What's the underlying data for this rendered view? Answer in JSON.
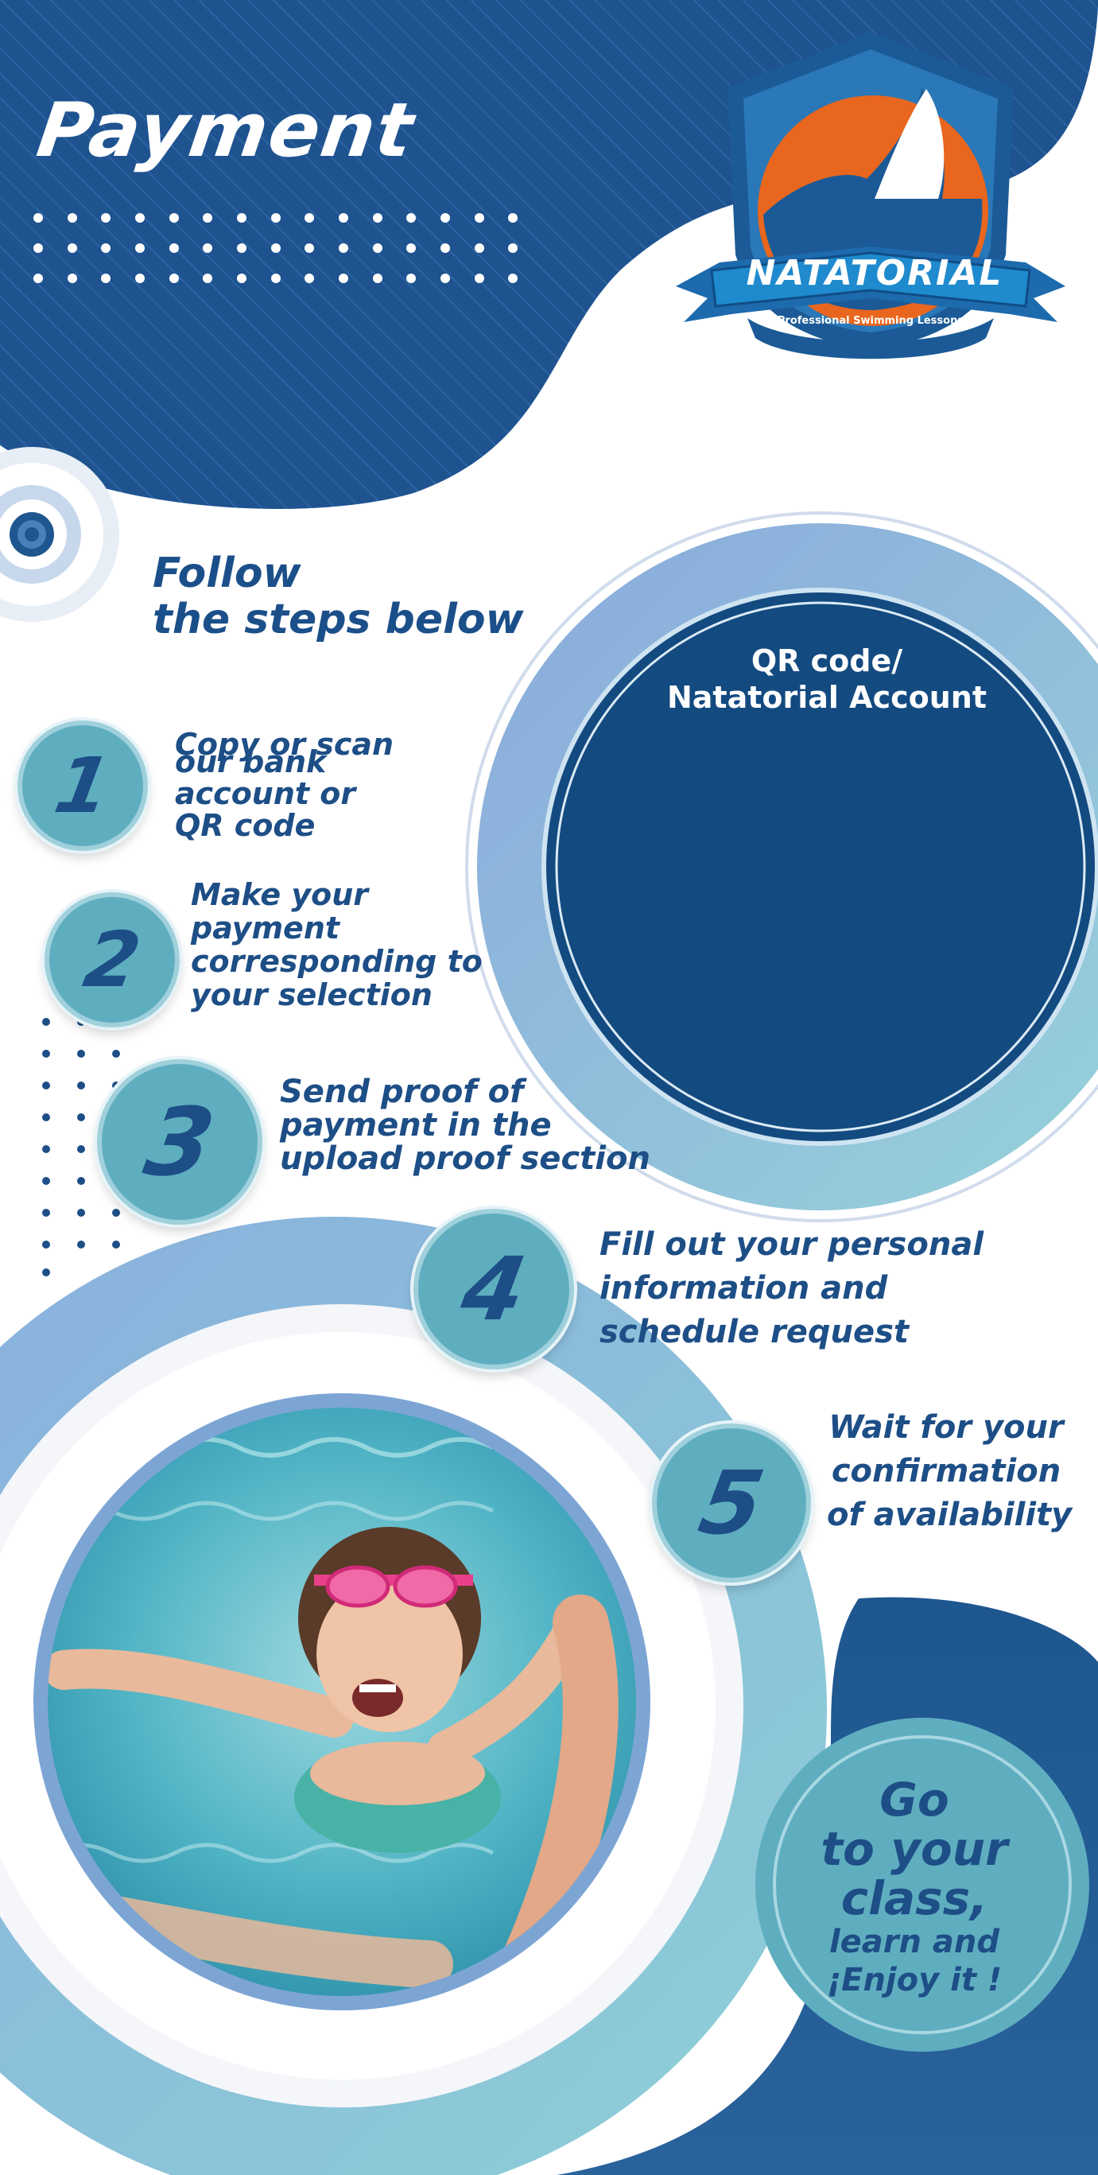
{
  "header": {
    "title": "Payment"
  },
  "logo": {
    "brand": "NATATORIAL",
    "tagline": "Professional Swimming Lessons"
  },
  "intro": {
    "line1": "Follow",
    "line2": "the steps below"
  },
  "qr_panel": {
    "line1": "QR code/",
    "line2": "Natatorial Account"
  },
  "steps": [
    {
      "number": "1",
      "lines": [
        "Copy or scan",
        "our bank",
        "account or",
        "QR code"
      ]
    },
    {
      "number": "2",
      "lines": [
        "Make your",
        "payment",
        "corresponding to",
        "your selection"
      ]
    },
    {
      "number": "3",
      "lines": [
        "Send proof of",
        "payment in the",
        "upload proof section"
      ]
    },
    {
      "number": "4",
      "lines": [
        "Fill out your personal",
        "information and",
        "schedule request"
      ]
    },
    {
      "number": "5",
      "lines": [
        "Wait for your",
        "confirmation",
        "of availability"
      ]
    }
  ],
  "final": {
    "line1": "Go",
    "line2": "to your",
    "line3": "class,",
    "line4": "learn and",
    "line5": "¡Enjoy it !"
  },
  "colors": {
    "navy": "#1b4f8a",
    "dark_navy": "#134a80",
    "teal": "#5faec0",
    "light_blue": "#8fb6dc",
    "orange": "#e8661e"
  },
  "photo": {
    "icon": "child-swimming-photo"
  }
}
